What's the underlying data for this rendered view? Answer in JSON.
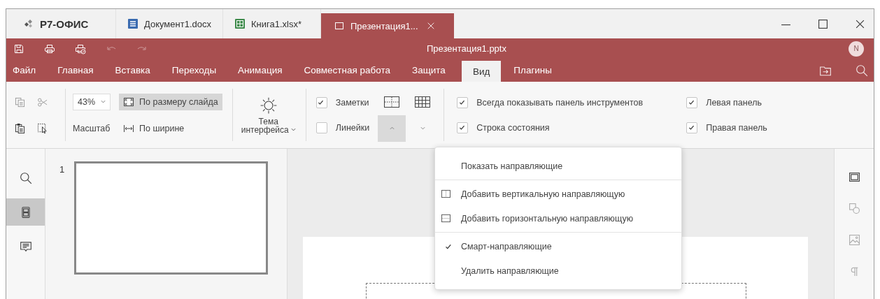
{
  "app_tabs": [
    {
      "kind": "logo",
      "label": "Р7-ОФИС",
      "selected": false
    },
    {
      "kind": "document",
      "label": "Документ1.docx",
      "selected": false
    },
    {
      "kind": "spreadsheet",
      "label": "Книга1.xlsx*",
      "selected": false
    },
    {
      "kind": "presentation",
      "label": "Презентация1...",
      "selected": true
    }
  ],
  "title_bar": {
    "title": "Презентация1.pptx",
    "avatar": "N",
    "quick_access": [
      {
        "kind": "save",
        "disabled": false
      },
      {
        "kind": "print",
        "disabled": false
      },
      {
        "kind": "quick-print",
        "disabled": false
      },
      {
        "kind": "undo",
        "disabled": true
      },
      {
        "kind": "redo",
        "disabled": true
      }
    ]
  },
  "menu_tabs": [
    {
      "label": "Файл",
      "selected": false
    },
    {
      "label": "Главная",
      "selected": false
    },
    {
      "label": "Вставка",
      "selected": false
    },
    {
      "label": "Переходы",
      "selected": false
    },
    {
      "label": "Анимация",
      "selected": false
    },
    {
      "label": "Совместная работа",
      "selected": false
    },
    {
      "label": "Защита",
      "selected": false
    },
    {
      "label": "Вид",
      "selected": true
    },
    {
      "label": "Плагины",
      "selected": false
    }
  ],
  "toolbar": {
    "clipboard": [
      {
        "kind": "copy",
        "disabled": true
      },
      {
        "kind": "cut",
        "disabled": true
      },
      {
        "kind": "paste",
        "disabled": false
      },
      {
        "kind": "select",
        "disabled": false
      }
    ],
    "zoom": {
      "value": "43%",
      "label": "Масштаб"
    },
    "fit_slide": {
      "label": "По размеру слайда",
      "selected": true
    },
    "fit_width": {
      "label": "По ширине",
      "selected": false
    },
    "theme": {
      "label_1": "Тема",
      "label_2": "интерфейса"
    },
    "view_checks": [
      {
        "label": "Заметки",
        "checked": true
      },
      {
        "label": "Линейки",
        "checked": false
      }
    ],
    "guides_button": {
      "expanded": true
    },
    "gridlines_button": {
      "expanded": false
    },
    "panel_checks_1": [
      {
        "label": "Всегда показывать панель инструментов",
        "checked": true
      },
      {
        "label": "Строка состояния",
        "checked": true
      }
    ],
    "panel_checks_2": [
      {
        "label": "Левая панель",
        "checked": true
      },
      {
        "label": "Правая панель",
        "checked": true
      }
    ]
  },
  "left_rail": [
    {
      "kind": "search",
      "selected": false
    },
    {
      "kind": "slides",
      "selected": true
    },
    {
      "kind": "comments",
      "selected": false
    }
  ],
  "slides": [
    {
      "number": "1",
      "selected": true
    }
  ],
  "right_rail": [
    {
      "kind": "slide-settings",
      "disabled": false
    },
    {
      "kind": "shape",
      "disabled": true
    },
    {
      "kind": "image",
      "disabled": true
    },
    {
      "kind": "paragraph",
      "disabled": true
    }
  ],
  "guides_menu": {
    "sections": [
      {
        "items": [
          {
            "kind": "plain",
            "label": "Показать направляющие",
            "checked": false
          }
        ]
      },
      {
        "items": [
          {
            "kind": "vertical",
            "label": "Добавить вертикальную направляющую",
            "checked": false
          },
          {
            "kind": "horizontal",
            "label": "Добавить горизонтальную направляющую",
            "checked": false
          }
        ]
      },
      {
        "items": [
          {
            "kind": "plain",
            "label": "Смарт-направляющие",
            "checked": true
          },
          {
            "kind": "plain",
            "label": "Удалить направляющие",
            "checked": false
          }
        ]
      }
    ]
  }
}
